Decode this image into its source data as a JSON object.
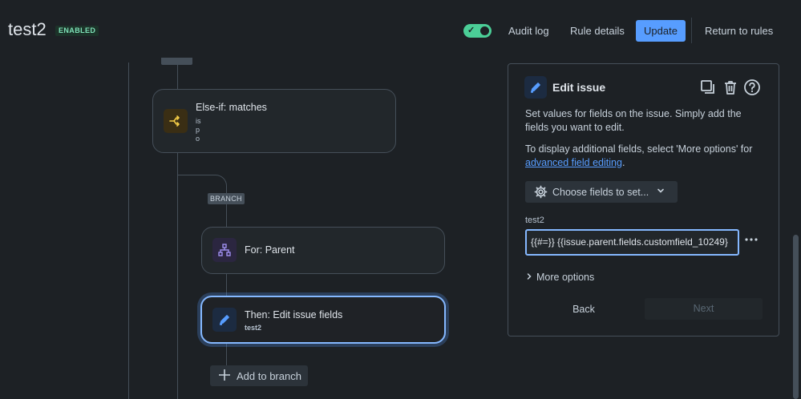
{
  "header": {
    "title": "test2",
    "status_badge": "ENABLED",
    "toggle_check": "✓",
    "audit_log": "Audit log",
    "rule_details": "Rule details",
    "update": "Update",
    "return_to_rules": "Return to rules"
  },
  "canvas": {
    "branch_tag": "BRANCH",
    "nodes": [
      {
        "icon": "branch-condition-icon",
        "title": "Else-if: matches",
        "sub": [
          "is",
          "p",
          "o"
        ]
      },
      {
        "icon": "hierarchy-icon",
        "title": "For: Parent",
        "sub": []
      },
      {
        "icon": "pencil-icon",
        "title": "Then: Edit issue fields",
        "sub": [
          "test2"
        ],
        "selected": true
      }
    ],
    "add_to_branch": "Add to branch"
  },
  "panel": {
    "title": "Edit issue",
    "desc1": "Set values for fields on the issue. Simply add the fields you want to edit.",
    "desc2_prefix": "To display additional fields, select 'More options' for",
    "desc2_link": "advanced field editing",
    "desc2_suffix": ".",
    "choose_fields": "Choose fields to set...",
    "field_label": "test2",
    "field_value": "{{#=}} {{issue.parent.fields.customfield_10249}",
    "more_options": "More options",
    "back": "Back",
    "next": "Next"
  },
  "colors": {
    "background": "#1d2125",
    "accent": "#579dff",
    "enabled": "#4bce97"
  }
}
